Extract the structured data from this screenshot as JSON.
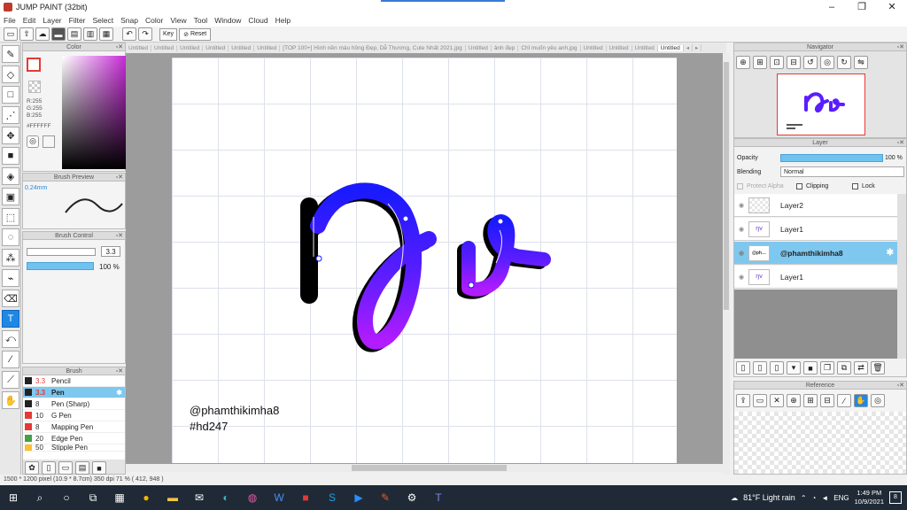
{
  "window": {
    "title": "JUMP PAINT (32bit)"
  },
  "menu": [
    "File",
    "Edit",
    "Layer",
    "Filter",
    "Select",
    "Snap",
    "Color",
    "View",
    "Tool",
    "Window",
    "Cloud",
    "Help"
  ],
  "toolbar": {
    "key_label": "Key",
    "reset_label": "Reset"
  },
  "color_panel": {
    "title": "Color",
    "r": "R:255",
    "g": "G:255",
    "b": "B:255",
    "hex": "#FFFFFF"
  },
  "brush_preview": {
    "title": "Brush Preview",
    "size_label": "0.24mm"
  },
  "brush_control": {
    "title": "Brush Control",
    "size_value": "3.3",
    "opacity_value": "100 %"
  },
  "brush_panel": {
    "title": "Brush",
    "items": [
      {
        "size": "3.3",
        "name": "Pencil",
        "color": "#222222"
      },
      {
        "size": "3.3",
        "name": "Pen",
        "color": "#222222"
      },
      {
        "size": "8",
        "name": "Pen (Sharp)",
        "color": "#222222"
      },
      {
        "size": "10",
        "name": "G Pen",
        "color": "#e53935"
      },
      {
        "size": "8",
        "name": "Mapping Pen",
        "color": "#e53935"
      },
      {
        "size": "20",
        "name": "Edge Pen",
        "color": "#43a047"
      },
      {
        "size": "50",
        "name": "Stipple Pen",
        "color": "#fbc02d"
      }
    ]
  },
  "doc_tabs": [
    "Untitled",
    "Untitled",
    "Untitled",
    "Untitled",
    "Untitled",
    "Untitled",
    "[TOP 100+] Hình nền màu hồng Đẹp, Dễ Thương, Cute Nhất 2021.jpg",
    "Untitled",
    "ảnh đẹp",
    "Chỉ muốn yêu anh.jpg",
    "Untitled",
    "Untitled",
    "Untitled",
    "Untitled"
  ],
  "canvas": {
    "handle": "@phamthikimha8",
    "tag": "#hd247"
  },
  "navigator": {
    "title": "Navigator"
  },
  "layer_panel": {
    "title": "Layer",
    "opacity_label": "Opacity",
    "opacity_value": "100 %",
    "blending_label": "Blending",
    "blending_value": "Normal",
    "protect_alpha": "Protect Alpha",
    "clipping": "Clipping",
    "lock": "Lock",
    "layers": [
      "Layer2",
      "Layer1",
      "@phamthikimha8",
      "Layer1"
    ]
  },
  "reference": {
    "title": "Reference"
  },
  "status": {
    "text": "1500 * 1200 pixel  (10.9 * 8.7cm)  350 dpi  71 %  ( 412, 948 )"
  },
  "taskbar": {
    "weather": "81°F  Light rain",
    "lang": "ENG",
    "time": "1:49 PM",
    "date": "10/9/2021",
    "notif_count": "8"
  }
}
